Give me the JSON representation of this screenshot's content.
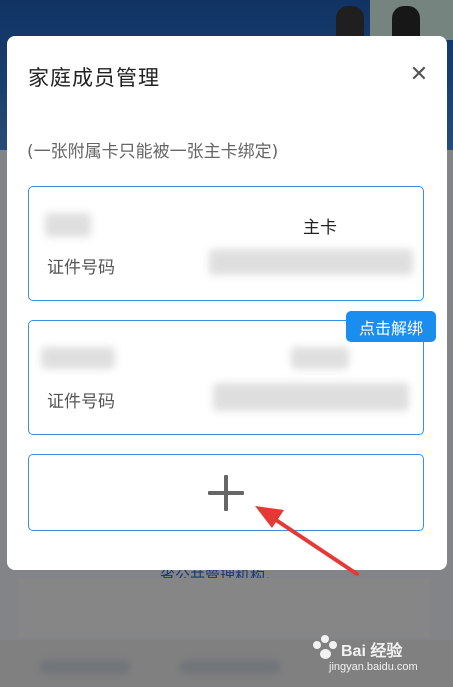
{
  "background": {
    "link_text": "省公共管理机构。"
  },
  "watermark": {
    "brand": "Bai 经验",
    "url": "jingyan.baidu.com"
  },
  "modal": {
    "title": "家庭成员管理",
    "close_symbol": "✕",
    "note": "(一张附属卡只能被一张主卡绑定)",
    "cards": [
      {
        "id_label": "证件号码",
        "tag": "主卡"
      },
      {
        "id_label": "证件号码"
      }
    ],
    "unbind_label": "点击解绑"
  },
  "colors": {
    "accent": "#1a8df0",
    "card_border": "#3b8fe0",
    "arrow": "#e53935"
  }
}
